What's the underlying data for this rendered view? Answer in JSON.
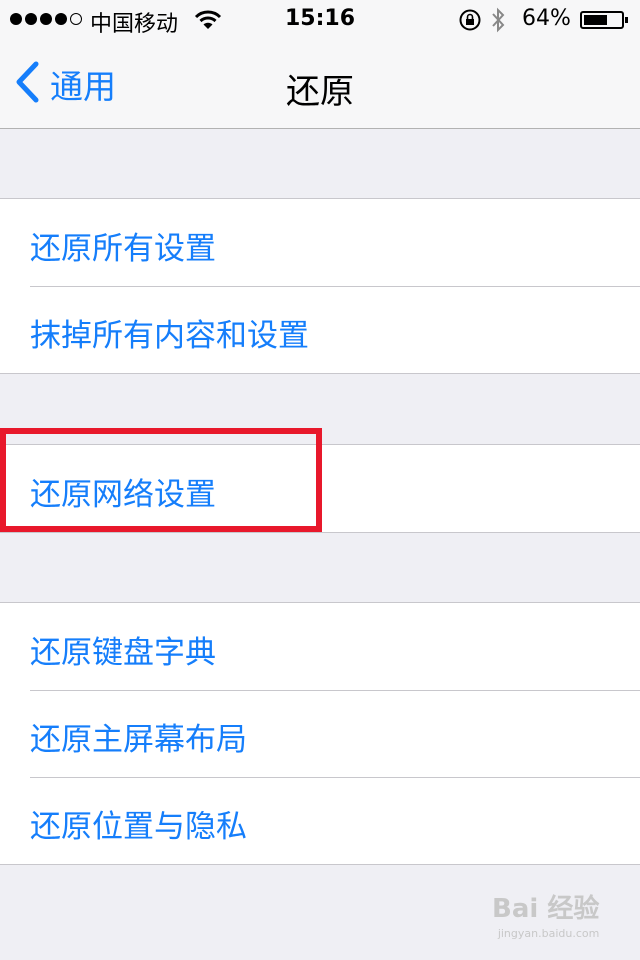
{
  "status_bar": {
    "carrier": "中国移动",
    "time": "15:16",
    "battery_percent": "64%",
    "battery_level": 0.64,
    "signal_bars": 4,
    "icons": [
      "signal-dots-icon",
      "wifi-icon",
      "rotation-lock-icon",
      "bluetooth-icon",
      "battery-icon"
    ]
  },
  "nav": {
    "back_label": "通用",
    "title": "还原"
  },
  "groups": [
    {
      "items": [
        {
          "label": "还原所有设置"
        },
        {
          "label": "抹掉所有内容和设置"
        }
      ]
    },
    {
      "items": [
        {
          "label": "还原网络设置",
          "highlighted": true
        }
      ]
    },
    {
      "items": [
        {
          "label": "还原键盘字典"
        },
        {
          "label": "还原主屏幕布局"
        },
        {
          "label": "还原位置与隐私"
        }
      ]
    }
  ],
  "watermark": {
    "line1": "Bai 经验",
    "line2": "jingyan.baidu.com"
  },
  "colors": {
    "accent": "#157efb",
    "background": "#efeff4",
    "highlight": "#e8182b"
  }
}
